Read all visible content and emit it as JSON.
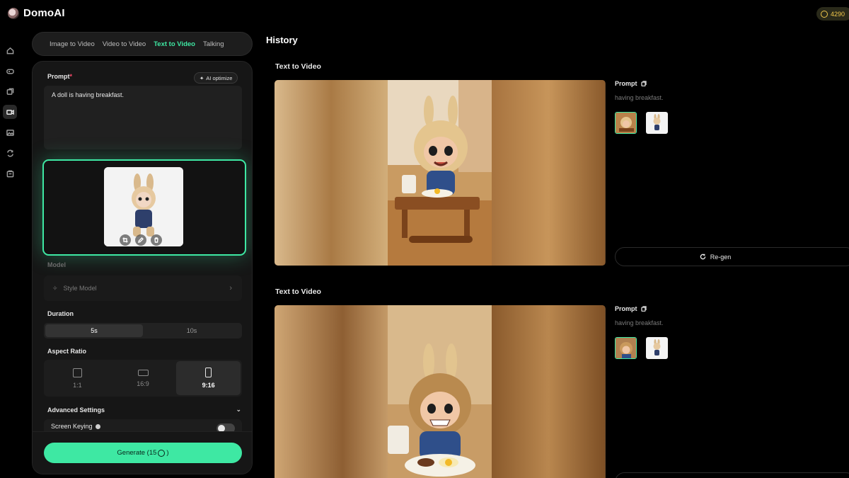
{
  "app": {
    "name": "DomoAI",
    "credits": "4290"
  },
  "tabs": [
    {
      "label": "Image to Video",
      "active": false
    },
    {
      "label": "Video to Video",
      "active": false
    },
    {
      "label": "Text to Video",
      "active": true
    },
    {
      "label": "Talking",
      "active": false
    }
  ],
  "sidebar": {
    "items": [
      {
        "icon": "home-icon"
      },
      {
        "icon": "game-controller-icon"
      },
      {
        "icon": "layers-icon"
      },
      {
        "icon": "video-icon",
        "active": true
      },
      {
        "icon": "image-icon"
      },
      {
        "icon": "repeat-icon"
      },
      {
        "icon": "tools-icon"
      }
    ]
  },
  "form": {
    "prompt_label": "Prompt",
    "required_mark": "*",
    "ai_optimize_label": "AI optimize",
    "prompt_value": "A doll is having breakfast.",
    "model_label": "Model",
    "model_value": "Style Model",
    "duration_label": "Duration",
    "durations": [
      {
        "label": "5s",
        "active": true
      },
      {
        "label": "10s",
        "active": false
      }
    ],
    "aspect_label": "Aspect Ratio",
    "aspects": [
      {
        "label": "1:1",
        "active": false
      },
      {
        "label": "16:9",
        "active": false
      },
      {
        "label": "9:16",
        "active": true
      }
    ],
    "advanced_label": "Advanced Settings",
    "screen_keying_label": "Screen Keying",
    "generate_label": "Generate (15",
    "generate_suffix": ")"
  },
  "history": {
    "title": "History",
    "items": [
      {
        "title": "Text to Video",
        "prompt_label": "Prompt",
        "prompt_text": "having breakfast.",
        "regen_label": "Re-gen"
      },
      {
        "title": "Text to Video",
        "prompt_label": "Prompt",
        "prompt_text": "having breakfast."
      }
    ]
  },
  "colors": {
    "accent": "#3ee8a3",
    "background": "#000000",
    "panel": "#161616",
    "credits": "#f2c94c"
  }
}
